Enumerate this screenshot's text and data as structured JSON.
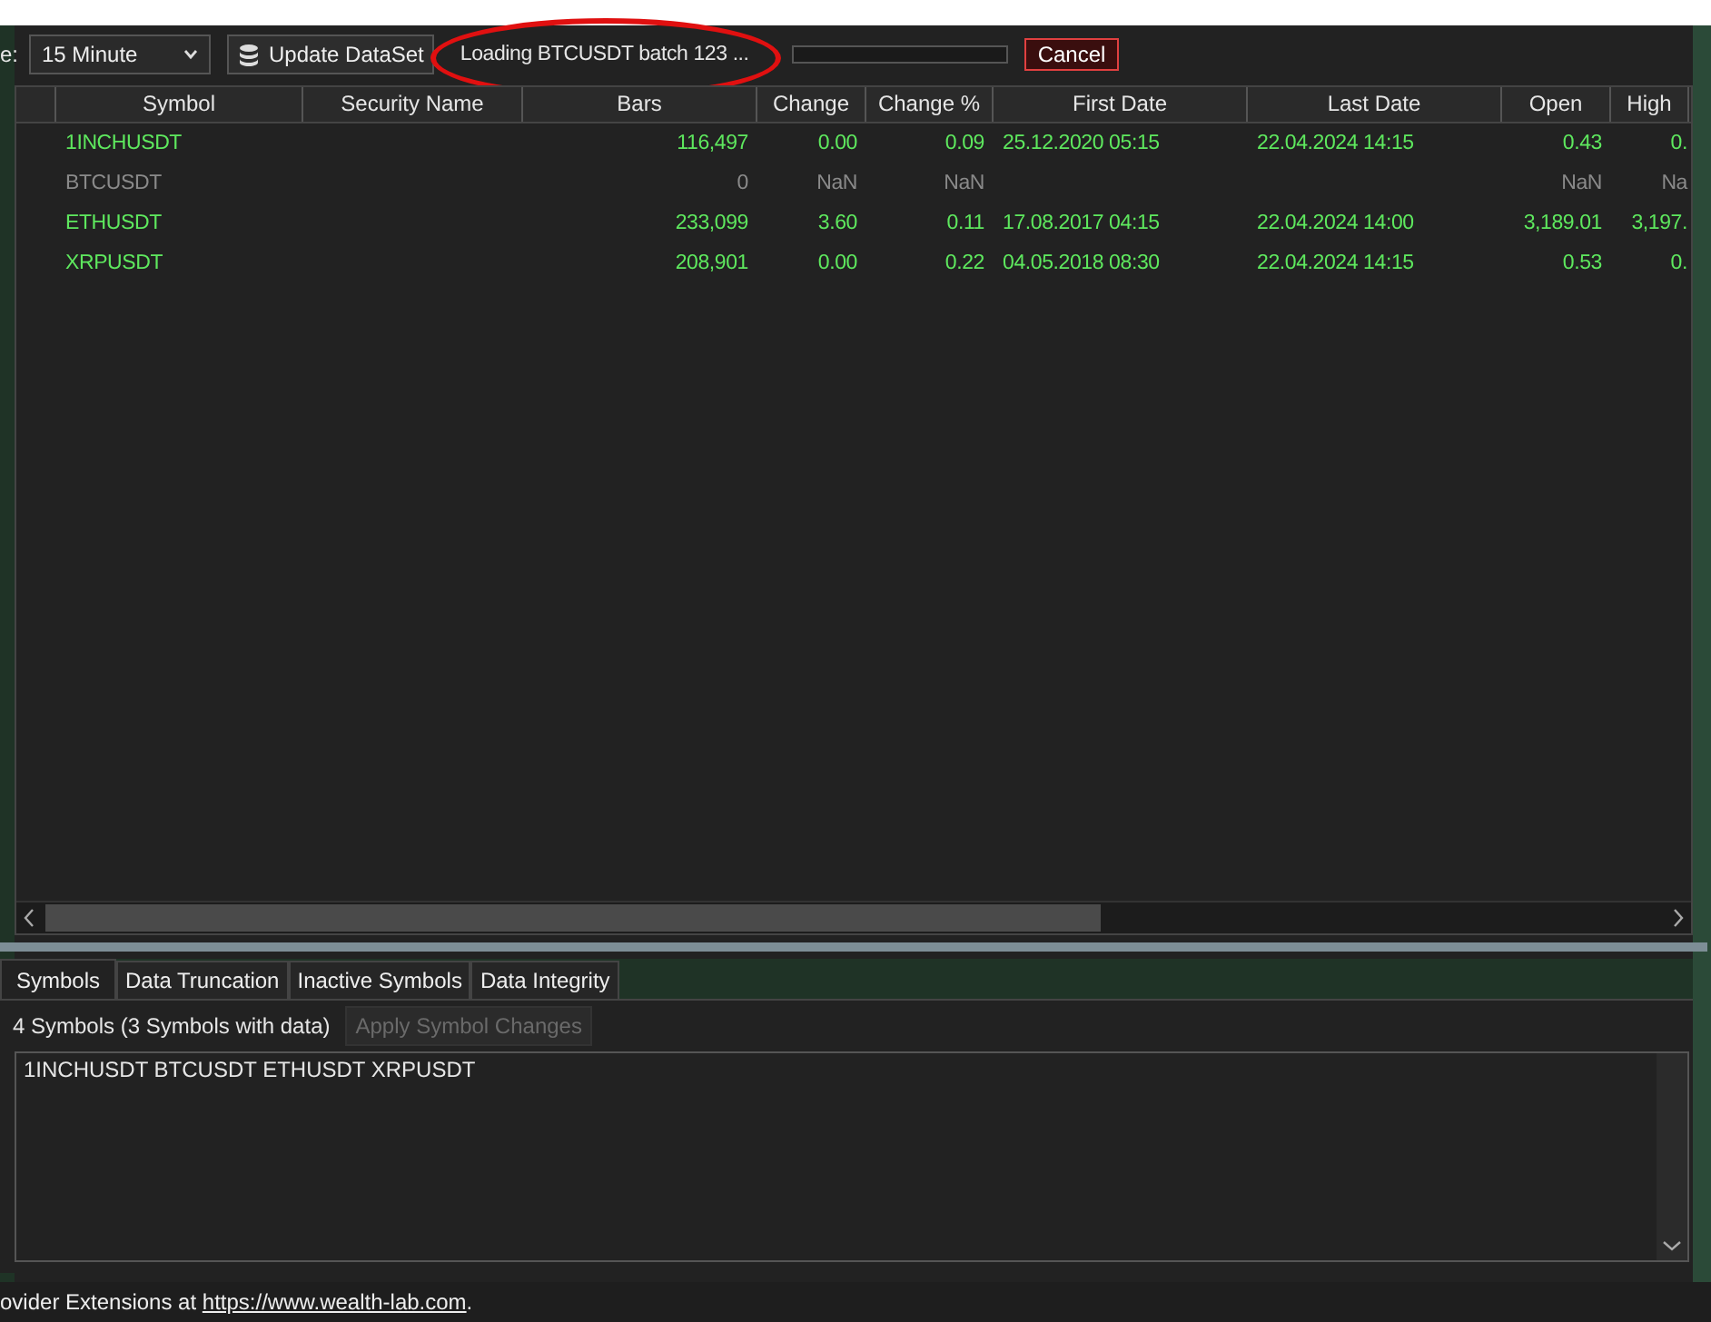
{
  "toolbar": {
    "label_fragment": "e:",
    "interval": "15 Minute",
    "update_button": "Update DataSet",
    "status": "Loading BTCUSDT batch 123 ...",
    "progress": {
      "level": 0
    },
    "cancel_button": "Cancel"
  },
  "table": {
    "columns": [
      "Symbol",
      "Security Name",
      "Bars",
      "Change",
      "Change %",
      "First Date",
      "Last Date",
      "Open",
      "High"
    ],
    "rows": [
      {
        "has_data": true,
        "cells": [
          "1INCHUSDT",
          "",
          "116,497",
          "0.00",
          "0.09",
          "25.12.2020 05:15",
          "22.04.2024 14:15",
          "0.43",
          "0."
        ]
      },
      {
        "has_data": false,
        "cells": [
          "BTCUSDT",
          "",
          "0",
          "NaN",
          "NaN",
          "",
          "",
          "NaN",
          "Na"
        ]
      },
      {
        "has_data": true,
        "cells": [
          "ETHUSDT",
          "",
          "233,099",
          "3.60",
          "0.11",
          "17.08.2017 04:15",
          "22.04.2024 14:00",
          "3,189.01",
          "3,197."
        ]
      },
      {
        "has_data": true,
        "cells": [
          "XRPUSDT",
          "",
          "208,901",
          "0.00",
          "0.22",
          "04.05.2018 08:30",
          "22.04.2024 14:15",
          "0.53",
          "0."
        ]
      }
    ]
  },
  "tabs": [
    {
      "label": "Symbols",
      "selected": true
    },
    {
      "label": "Data Truncation",
      "selected": false
    },
    {
      "label": "Inactive Symbols",
      "selected": false
    },
    {
      "label": "Data Integrity",
      "selected": false
    }
  ],
  "symbols_panel": {
    "summary": "4 Symbols (3 Symbols with data)",
    "apply_button": {
      "label": "Apply Symbol Changes",
      "disabled": true
    },
    "symbols_text": "1INCHUSDT BTCUSDT ETHUSDT XRPUSDT"
  },
  "footer": {
    "text": "ovider Extensions at ",
    "link": "https://www.wealth-lab.com",
    "end": "."
  }
}
